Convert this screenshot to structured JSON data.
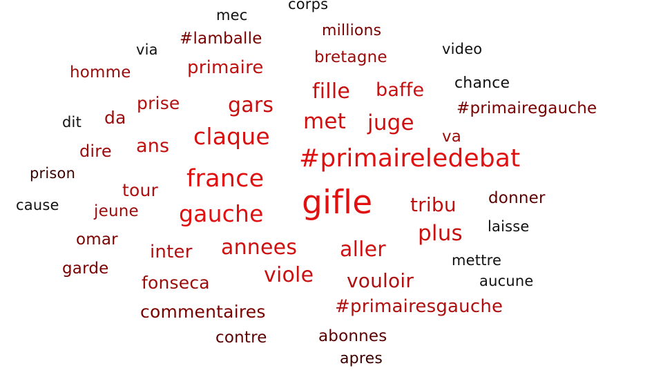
{
  "palette": {
    "red": "#e01010",
    "mid_red": "#b80f0f",
    "dark_red": "#7a0000",
    "black": "#111111"
  },
  "words": [
    {
      "text": "corps",
      "color": "#111111"
    },
    {
      "text": "mec",
      "color": "#111111"
    },
    {
      "text": "millions",
      "color": "#7a0000"
    },
    {
      "text": "#lamballe",
      "color": "#7a0000"
    },
    {
      "text": "via",
      "color": "#111111"
    },
    {
      "text": "bretagne",
      "color": "#9a0b0b"
    },
    {
      "text": "video",
      "color": "#111111"
    },
    {
      "text": "primaire",
      "color": "#c01010"
    },
    {
      "text": "homme",
      "color": "#9a0b0b"
    },
    {
      "text": "chance",
      "color": "#111111"
    },
    {
      "text": "fille",
      "color": "#c81010"
    },
    {
      "text": "baffe",
      "color": "#c81010"
    },
    {
      "text": "prise",
      "color": "#b00f0f"
    },
    {
      "text": "gars",
      "color": "#c81010"
    },
    {
      "text": "#primairegauche",
      "color": "#7a0000"
    },
    {
      "text": "da",
      "color": "#9a0b0b"
    },
    {
      "text": "met",
      "color": "#d01010"
    },
    {
      "text": "juge",
      "color": "#d01010"
    },
    {
      "text": "dit",
      "color": "#111111"
    },
    {
      "text": "claque",
      "color": "#d81010"
    },
    {
      "text": "va",
      "color": "#9a0b0b"
    },
    {
      "text": "ans",
      "color": "#c01010"
    },
    {
      "text": "dire",
      "color": "#9a0b0b"
    },
    {
      "text": "#primaireledebat",
      "color": "#e01010"
    },
    {
      "text": "prison",
      "color": "#3a0000"
    },
    {
      "text": "france",
      "color": "#e01010"
    },
    {
      "text": "tour",
      "color": "#b00f0f"
    },
    {
      "text": "gifle",
      "color": "#e01010"
    },
    {
      "text": "donner",
      "color": "#5a0000"
    },
    {
      "text": "cause",
      "color": "#111111"
    },
    {
      "text": "jeune",
      "color": "#9a0b0b"
    },
    {
      "text": "tribu",
      "color": "#c01010"
    },
    {
      "text": "gauche",
      "color": "#e01010"
    },
    {
      "text": "laisse",
      "color": "#111111"
    },
    {
      "text": "plus",
      "color": "#c81010"
    },
    {
      "text": "omar",
      "color": "#7a0000"
    },
    {
      "text": "annees",
      "color": "#d01010"
    },
    {
      "text": "inter",
      "color": "#b00f0f"
    },
    {
      "text": "aller",
      "color": "#d01010"
    },
    {
      "text": "mettre",
      "color": "#111111"
    },
    {
      "text": "garde",
      "color": "#7a0000"
    },
    {
      "text": "viole",
      "color": "#c81010"
    },
    {
      "text": "fonseca",
      "color": "#9a0b0b"
    },
    {
      "text": "vouloir",
      "color": "#b00f0f"
    },
    {
      "text": "aucune",
      "color": "#111111"
    },
    {
      "text": "commentaires",
      "color": "#7a0000"
    },
    {
      "text": "#primairesgauche",
      "color": "#b00f0f"
    },
    {
      "text": "contre",
      "color": "#5a0000"
    },
    {
      "text": "abonnes",
      "color": "#5a0000"
    },
    {
      "text": "apres",
      "color": "#3a0000"
    }
  ]
}
